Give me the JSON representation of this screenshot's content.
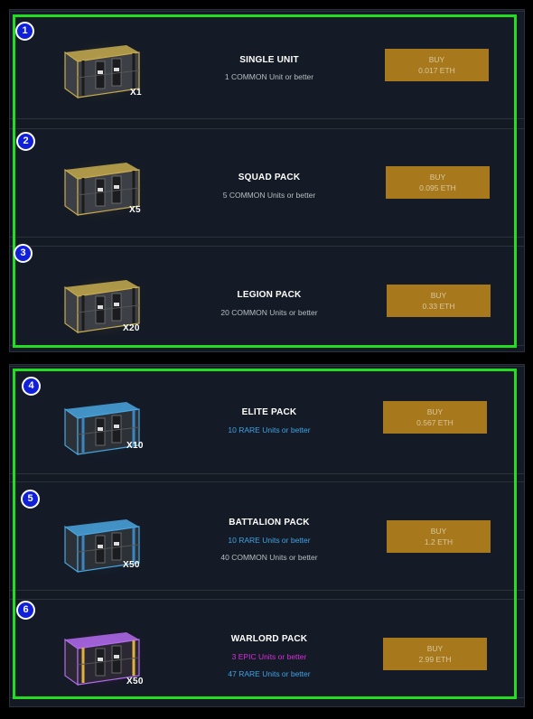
{
  "packs": [
    {
      "badge": "1",
      "title": "SINGLE UNIT",
      "quantity": "X1",
      "lines": [
        {
          "text": "1 COMMON Unit or better",
          "rarity": "common"
        }
      ],
      "buy_label": "BUY",
      "price": "0.017 ETH",
      "crate": "gold-crate-icon"
    },
    {
      "badge": "2",
      "title": "SQUAD PACK",
      "quantity": "X5",
      "lines": [
        {
          "text": "5 COMMON Units or better",
          "rarity": "common"
        }
      ],
      "buy_label": "BUY",
      "price": "0.095 ETH",
      "crate": "gold-crate-icon"
    },
    {
      "badge": "3",
      "title": "LEGION PACK",
      "quantity": "X20",
      "lines": [
        {
          "text": "20 COMMON Units or better",
          "rarity": "common"
        }
      ],
      "buy_label": "BUY",
      "price": "0.33 ETH",
      "crate": "gold-crate-icon"
    },
    {
      "badge": "4",
      "title": "ELITE PACK",
      "quantity": "X10",
      "lines": [
        {
          "text": "10 RARE Units or better",
          "rarity": "rare"
        }
      ],
      "buy_label": "BUY",
      "price": "0.567 ETH",
      "crate": "blue-crate-icon"
    },
    {
      "badge": "5",
      "title": "BATTALION PACK",
      "quantity": "X50",
      "lines": [
        {
          "text": "10 RARE Units or better",
          "rarity": "rare"
        },
        {
          "text": "40 COMMON Units or better",
          "rarity": "common"
        }
      ],
      "buy_label": "BUY",
      "price": "1.2 ETH",
      "crate": "blue-crate-icon"
    },
    {
      "badge": "6",
      "title": "WARLORD PACK",
      "quantity": "X50",
      "lines": [
        {
          "text": "3 EPIC Units or better",
          "rarity": "epic"
        },
        {
          "text": "47 RARE Units or better",
          "rarity": "rare"
        }
      ],
      "buy_label": "BUY",
      "price": "2.99 ETH",
      "crate": "purple-crate-icon"
    }
  ],
  "colors": {
    "highlight_border": "#22dd22",
    "buy_button": "#a7781c",
    "rare_text": "#3ea3e8",
    "epic_text": "#d42fd8",
    "badge": "#1020d8"
  }
}
